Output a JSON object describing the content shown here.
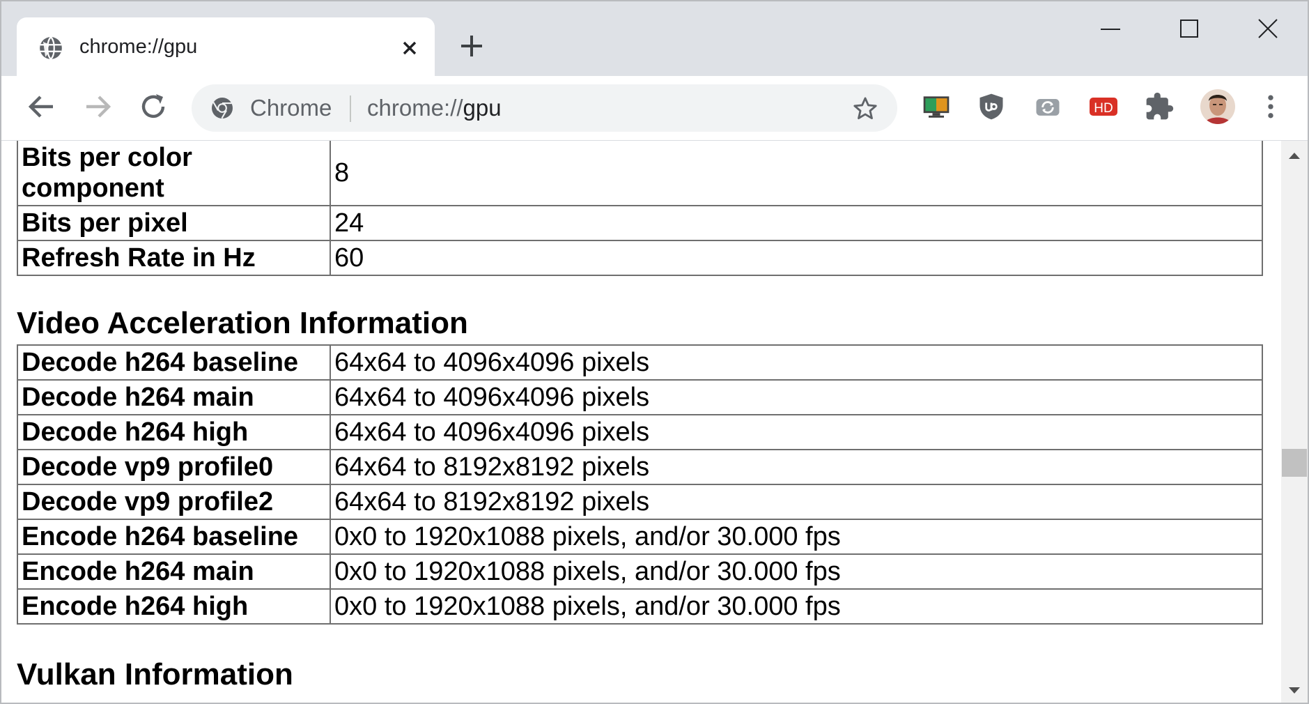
{
  "window": {
    "tab_title": "chrome://gpu",
    "omnibox_chip": "Chrome",
    "url_scheme": "chrome://",
    "url_host": "gpu"
  },
  "icons": {
    "tab_favicon": "globe-icon",
    "tab_close": "close-icon",
    "new_tab": "plus-icon",
    "minimize": "minimize-icon",
    "maximize": "maximize-icon",
    "close": "close-icon",
    "back": "back-arrow-icon",
    "forward": "forward-arrow-icon",
    "reload": "reload-icon",
    "bookmark": "star-icon",
    "extensions": [
      "monitor-icon",
      "ublock-icon",
      "sync-icon",
      "hd-icon",
      "puzzle-icon"
    ],
    "menu": "kebab-menu-icon"
  },
  "colors": {
    "tabstrip": "#dee1e6",
    "omnibox": "#f1f3f4",
    "hd_badge": "#d93025",
    "table_border": "#6f6f6f"
  },
  "extensions": {
    "hd_label": "HD"
  },
  "display_table": [
    {
      "key": "Bits per color component",
      "value": "8"
    },
    {
      "key": "Bits per pixel",
      "value": "24"
    },
    {
      "key": "Refresh Rate in Hz",
      "value": "60"
    }
  ],
  "video_section": {
    "heading": "Video Acceleration Information",
    "rows": [
      {
        "key": "Decode h264 baseline",
        "value": "64x64 to 4096x4096 pixels"
      },
      {
        "key": "Decode h264 main",
        "value": "64x64 to 4096x4096 pixels"
      },
      {
        "key": "Decode h264 high",
        "value": "64x64 to 4096x4096 pixels"
      },
      {
        "key": "Decode vp9 profile0",
        "value": "64x64 to 8192x8192 pixels"
      },
      {
        "key": "Decode vp9 profile2",
        "value": "64x64 to 8192x8192 pixels"
      },
      {
        "key": "Encode h264 baseline",
        "value": "0x0 to 1920x1088 pixels, and/or 30.000 fps"
      },
      {
        "key": "Encode h264 main",
        "value": "0x0 to 1920x1088 pixels, and/or 30.000 fps"
      },
      {
        "key": "Encode h264 high",
        "value": "0x0 to 1920x1088 pixels, and/or 30.000 fps"
      }
    ]
  },
  "vulkan_section": {
    "heading": "Vulkan Information"
  }
}
